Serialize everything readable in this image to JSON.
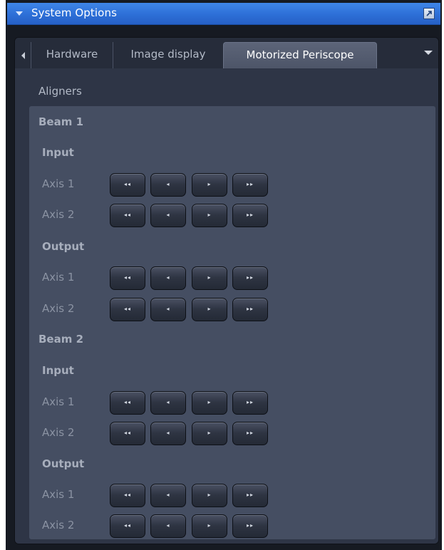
{
  "window": {
    "title": "System Options"
  },
  "tabs": [
    {
      "label": "Hardware"
    },
    {
      "label": "Image display"
    },
    {
      "label": "Motorized Periscope"
    }
  ],
  "section_heading": "Aligners",
  "button_glyphs": {
    "fast_back": "◂◂",
    "back": "◂",
    "forward": "▸",
    "fast_forward": "▸▸"
  },
  "beams": [
    {
      "label": "Beam 1",
      "groups": [
        {
          "label": "Input",
          "axes": [
            {
              "label": "Axis 1"
            },
            {
              "label": "Axis 2"
            }
          ]
        },
        {
          "label": "Output",
          "axes": [
            {
              "label": "Axis 1"
            },
            {
              "label": "Axis 2"
            }
          ]
        }
      ]
    },
    {
      "label": "Beam 2",
      "groups": [
        {
          "label": "Input",
          "axes": [
            {
              "label": "Axis 1"
            },
            {
              "label": "Axis 2"
            }
          ]
        },
        {
          "label": "Output",
          "axes": [
            {
              "label": "Axis 1"
            },
            {
              "label": "Axis 2"
            }
          ]
        }
      ]
    }
  ]
}
